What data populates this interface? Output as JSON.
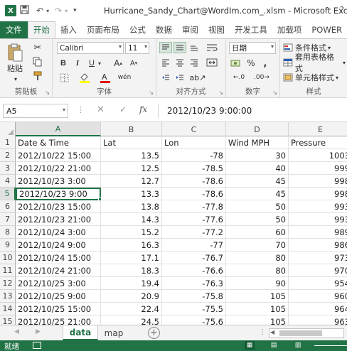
{
  "window": {
    "title": "Hurricane_Sandy_Chart@WordIm.com_.xlsm - Microsoft Excel",
    "help_glyph": "?"
  },
  "ribbon_tabs": {
    "file": "文件",
    "items": [
      "开始",
      "插入",
      "页面布局",
      "公式",
      "数据",
      "审阅",
      "视图",
      "开发工具",
      "加载项",
      "POWER"
    ]
  },
  "ribbon": {
    "clipboard": {
      "label": "剪贴板",
      "paste": "粘贴"
    },
    "font": {
      "label": "字体",
      "name": "Calibri",
      "size": "11",
      "bold": "B",
      "italic": "I",
      "underline": "U"
    },
    "alignment": {
      "label": "对齐方式"
    },
    "number": {
      "label": "数字",
      "format": "日期",
      "percent": "%",
      "comma": ","
    },
    "styles": {
      "label": "样式",
      "conditional": "条件格式",
      "table": "套用表格格式",
      "cell": "单元格样式"
    }
  },
  "formula_bar": {
    "name_box": "A5",
    "formula": "2012/10/23   9:00:00"
  },
  "grid": {
    "columns": [
      "A",
      "B",
      "C",
      "D",
      "E"
    ],
    "selected_column": "A",
    "selected_row": 5,
    "rows": [
      {
        "num": "1",
        "cells": [
          "Date & Time",
          "Lat",
          "Lon",
          "Wind MPH",
          "Pressure"
        ]
      },
      {
        "num": "2",
        "cells": [
          "2012/10/22 15:00",
          "13.5",
          "-78",
          "30",
          "1003"
        ]
      },
      {
        "num": "3",
        "cells": [
          "2012/10/22 21:00",
          "12.5",
          "-78.5",
          "40",
          "999"
        ]
      },
      {
        "num": "4",
        "cells": [
          "2012/10/23 3:00",
          "12.7",
          "-78.6",
          "45",
          "998"
        ]
      },
      {
        "num": "5",
        "cells": [
          "2012/10/23 9:00",
          "13.3",
          "-78.6",
          "45",
          "998"
        ]
      },
      {
        "num": "6",
        "cells": [
          "2012/10/23 15:00",
          "13.8",
          "-77.8",
          "50",
          "993"
        ]
      },
      {
        "num": "7",
        "cells": [
          "2012/10/23 21:00",
          "14.3",
          "-77.6",
          "50",
          "993"
        ]
      },
      {
        "num": "8",
        "cells": [
          "2012/10/24 3:00",
          "15.2",
          "-77.2",
          "60",
          "989"
        ]
      },
      {
        "num": "9",
        "cells": [
          "2012/10/24 9:00",
          "16.3",
          "-77",
          "70",
          "986"
        ]
      },
      {
        "num": "10",
        "cells": [
          "2012/10/24 15:00",
          "17.1",
          "-76.7",
          "80",
          "973"
        ]
      },
      {
        "num": "11",
        "cells": [
          "2012/10/24 21:00",
          "18.3",
          "-76.6",
          "80",
          "970"
        ]
      },
      {
        "num": "12",
        "cells": [
          "2012/10/25 3:00",
          "19.4",
          "-76.3",
          "90",
          "954"
        ]
      },
      {
        "num": "13",
        "cells": [
          "2012/10/25 9:00",
          "20.9",
          "-75.8",
          "105",
          "960"
        ]
      },
      {
        "num": "14",
        "cells": [
          "2012/10/25 15:00",
          "22.4",
          "-75.5",
          "105",
          "964"
        ]
      },
      {
        "num": "15",
        "cells": [
          "2012/10/25 21:00",
          "24.5",
          "-75.6",
          "105",
          "963"
        ]
      }
    ]
  },
  "sheets": {
    "tabs": [
      "data",
      "map"
    ],
    "active": "data"
  },
  "status": {
    "text": "就绪"
  },
  "colors": {
    "accent": "#217346"
  }
}
